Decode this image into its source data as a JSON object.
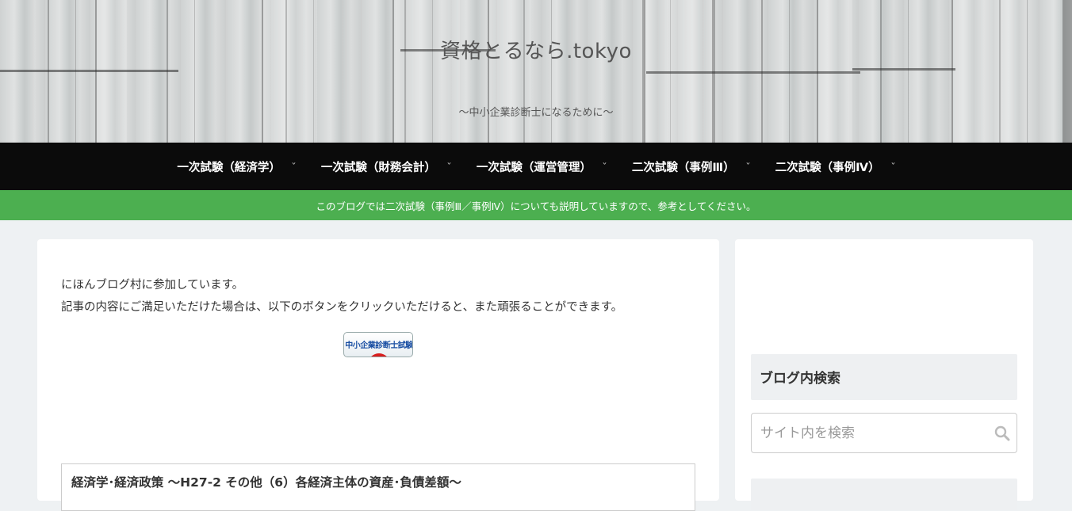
{
  "header": {
    "site_title": "資格とるなら.tokyo",
    "tagline": "～中小企業診断士になるために～"
  },
  "nav": {
    "items": [
      {
        "label": "一次試験（経済学）"
      },
      {
        "label": "一次試験（財務会計）"
      },
      {
        "label": "一次試験（運営管理）"
      },
      {
        "label": "二次試験（事例Ⅲ）"
      },
      {
        "label": "二次試験（事例Ⅳ）"
      }
    ]
  },
  "notice": {
    "text": "このブログでは二次試験（事例Ⅲ／事例Ⅳ）についても説明していますので、参考としてください。"
  },
  "main": {
    "intro_line1": "にほんブログ村に参加しています。",
    "intro_line2": "記事の内容にご満足いただけた場合は、以下のボタンをクリックいただけると、また頑張ることができます。",
    "badge_text": "中小企業診断士試験",
    "article_title": "経済学･経済政策 ～H27-2 その他（6）各経済主体の資産･負債差額～"
  },
  "sidebar": {
    "search_title": "ブログ内検索",
    "search_placeholder": "サイト内を検索"
  },
  "colors": {
    "nav_bg": "#0b0b0b",
    "notice_bg": "#4caf50",
    "page_bg": "#eef1f3",
    "badge_text": "#1a4fa3",
    "badge_sun": "#d81e1e"
  },
  "icons": [
    "chevron-down-icon",
    "search-icon"
  ]
}
